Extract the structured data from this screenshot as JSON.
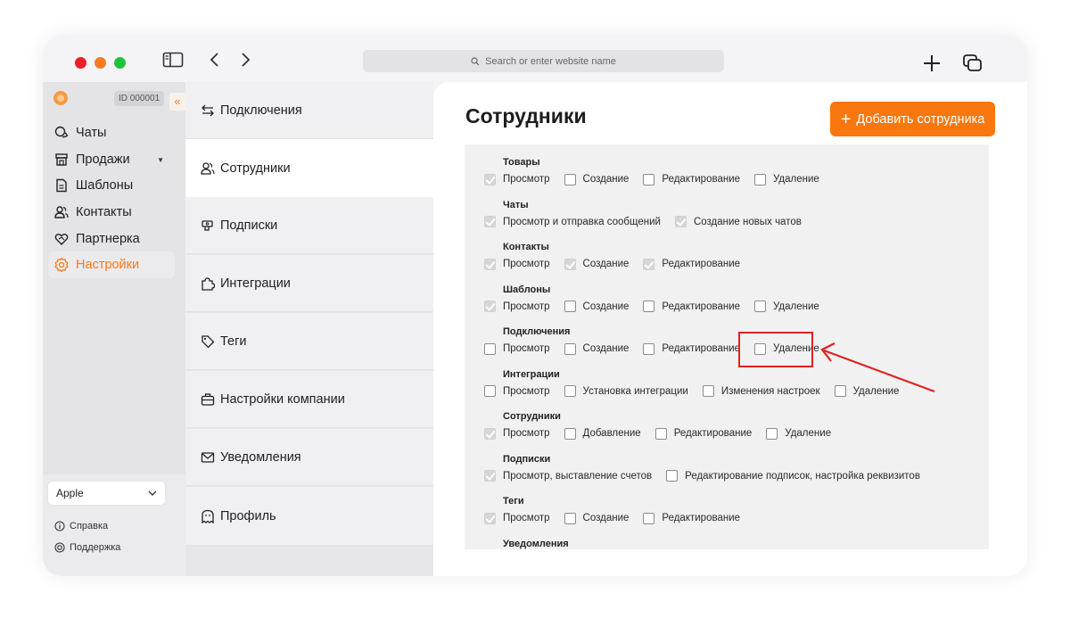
{
  "browser": {
    "url_placeholder": "Search or enter website name"
  },
  "sidebar": {
    "account_id": "ID 000001",
    "collapse_glyph": "«",
    "items": [
      {
        "label": "Чаты",
        "icon": "chat-icon"
      },
      {
        "label": "Продажи",
        "icon": "store-icon"
      },
      {
        "label": "Шаблоны",
        "icon": "document-icon"
      },
      {
        "label": "Контакты",
        "icon": "users-icon"
      },
      {
        "label": "Партнерка",
        "icon": "handshake-icon"
      },
      {
        "label": "Настройки",
        "icon": "gear-icon",
        "active": true
      }
    ],
    "workspace_select": "Apple",
    "help_label": "Справка",
    "support_label": "Поддержка"
  },
  "settings_menu": [
    {
      "label": "Подключения",
      "icon": "arrows-icon"
    },
    {
      "label": "Сотрудники",
      "icon": "users-icon",
      "active": true
    },
    {
      "label": "Подписки",
      "icon": "money-icon"
    },
    {
      "label": "Интеграции",
      "icon": "puzzle-icon"
    },
    {
      "label": "Теги",
      "icon": "tag-icon"
    },
    {
      "label": "Настройки компании",
      "icon": "briefcase-icon"
    },
    {
      "label": "Уведомления",
      "icon": "mail-icon"
    },
    {
      "label": "Профиль",
      "icon": "ghost-icon"
    }
  ],
  "main": {
    "title": "Сотрудники",
    "add_button": "Добавить сотрудника",
    "add_button_glyph": "+"
  },
  "permissions": [
    {
      "group": "Товары",
      "items": [
        {
          "label": "Просмотр",
          "checked": true
        },
        {
          "label": "Создание",
          "checked": false
        },
        {
          "label": "Редактирование",
          "checked": false
        },
        {
          "label": "Удаление",
          "checked": false
        }
      ]
    },
    {
      "group": "Чаты",
      "items": [
        {
          "label": "Просмотр и отправка сообщений",
          "checked": true
        },
        {
          "label": "Создание новых чатов",
          "checked": true
        }
      ]
    },
    {
      "group": "Контакты",
      "items": [
        {
          "label": "Просмотр",
          "checked": true
        },
        {
          "label": "Создание",
          "checked": true
        },
        {
          "label": "Редактирование",
          "checked": true
        }
      ]
    },
    {
      "group": "Шаблоны",
      "items": [
        {
          "label": "Просмотр",
          "checked": true
        },
        {
          "label": "Создание",
          "checked": false
        },
        {
          "label": "Редактирование",
          "checked": false
        },
        {
          "label": "Удаление",
          "checked": false
        }
      ]
    },
    {
      "group": "Подключения",
      "items": [
        {
          "label": "Просмотр",
          "checked": false
        },
        {
          "label": "Создание",
          "checked": false
        },
        {
          "label": "Редактирование",
          "checked": false
        },
        {
          "label": "Удаление",
          "checked": false
        }
      ]
    },
    {
      "group": "Интеграции",
      "items": [
        {
          "label": "Просмотр",
          "checked": false
        },
        {
          "label": "Установка интеграции",
          "checked": false
        },
        {
          "label": "Изменения настроек",
          "checked": false
        },
        {
          "label": "Удаление",
          "checked": false
        }
      ]
    },
    {
      "group": "Сотрудники",
      "items": [
        {
          "label": "Просмотр",
          "checked": true
        },
        {
          "label": "Добавление",
          "checked": false
        },
        {
          "label": "Редактирование",
          "checked": false
        },
        {
          "label": "Удаление",
          "checked": false
        }
      ]
    },
    {
      "group": "Подписки",
      "items": [
        {
          "label": "Просмотр, выставление счетов",
          "checked": true
        },
        {
          "label": "Редактирование подписок, настройка реквизитов",
          "checked": false
        }
      ]
    },
    {
      "group": "Теги",
      "items": [
        {
          "label": "Просмотр",
          "checked": true
        },
        {
          "label": "Создание",
          "checked": false
        },
        {
          "label": "Редактирование",
          "checked": false
        }
      ]
    },
    {
      "group": "Уведомления",
      "items": []
    }
  ],
  "colors": {
    "accent": "#f8770f",
    "annotation": "#e0211f"
  }
}
